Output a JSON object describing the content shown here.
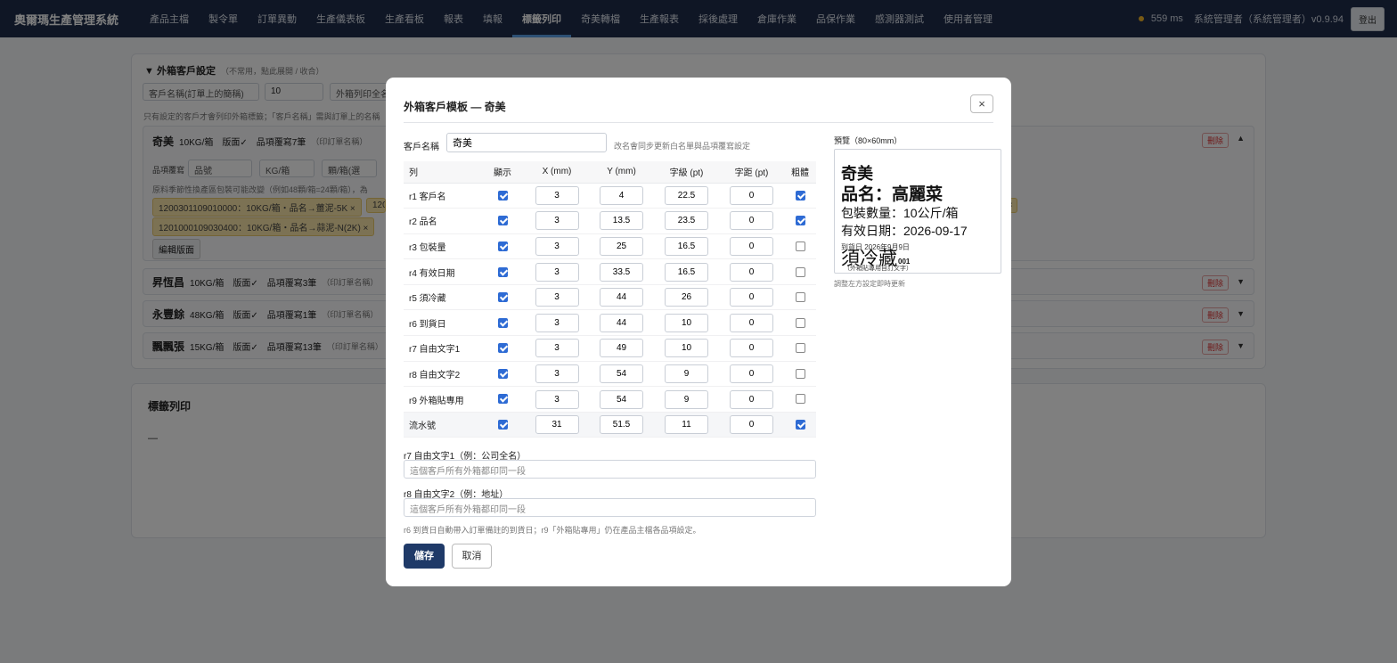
{
  "app": {
    "brand": "奧爾瑪生產管理系統"
  },
  "nav": {
    "items": [
      "產品主檔",
      "製令單",
      "訂單異動",
      "生產儀表板",
      "生產看板",
      "報表",
      "填報",
      "標籤列印",
      "奇美轉檔",
      "生產報表",
      "採後處理",
      "倉庫作業",
      "品保作業",
      "感測器測試",
      "使用者管理"
    ],
    "active": "標籤列印",
    "latency": "559 ms",
    "user": "系統管理者（系統管理者）v0.9.94",
    "logout": "登出"
  },
  "bg": {
    "section_title": "▼ 外箱客戶設定",
    "section_hint": "（不常用，點此展開 / 收合）",
    "field_customer_placeholder": "客戶名稱(訂單上的簡稱)",
    "field_qty": "10",
    "field_full_placeholder": "外箱列印全名",
    "note": "只有設定的客戶才會列印外箱標籤；「客戶名稱」需與訂單上的名稱",
    "customer_row": {
      "name": "奇美",
      "info": "10KG/箱　版面✓　品項覆寫7筆",
      "tag": "（印訂單名稱）"
    },
    "override_label": "品項覆寫",
    "override_fields": [
      "品號",
      "KG/箱",
      "顆/箱(選"
    ],
    "override_note": "原料季節性換產區包裝可能改變（例如48顆/箱=24顆/箱），為",
    "chips": [
      "1200301109010000：10KG/箱・品名→薑泥-5K ×",
      "1201000109030400：10KG/箱・品名→蒜泥-N(2K) ×"
    ],
    "chip_x": "×",
    "chip_trunc": "120",
    "edit_layout": "編輯版面",
    "rows": [
      {
        "name": "昇恆昌",
        "info": "10KG/箱　版面✓　品項覆寫3筆",
        "tag": "（印訂單名稱）"
      },
      {
        "name": "永豐餘",
        "info": "48KG/箱　版面✓　品項覆寫1筆",
        "tag": "（印訂單名稱）"
      },
      {
        "name": "飄飄張",
        "info": "15KG/箱　版面✓　品項覆寫13筆",
        "tag": "（印訂單名稱）"
      }
    ],
    "delete_label": "刪除",
    "label_print_title": "標籤列印",
    "label_print_dash": "—"
  },
  "modal": {
    "title": "外箱客戶模板 — 奇美",
    "close": "×",
    "customer_label": "客戶名稱",
    "customer_value": "奇美",
    "customer_hint": "改名會同步更新白名單與品項覆寫設定",
    "columns": [
      "列",
      "顯示",
      "X (mm)",
      "Y (mm)",
      "字級 (pt)",
      "字距 (pt)",
      "粗體"
    ],
    "rows": [
      {
        "label": "r1 客戶名",
        "show": true,
        "x": "3",
        "y": "4",
        "size": "22.5",
        "spacing": "0",
        "bold": true
      },
      {
        "label": "r2 品名",
        "show": true,
        "x": "3",
        "y": "13.5",
        "size": "23.5",
        "spacing": "0",
        "bold": true
      },
      {
        "label": "r3 包裝量",
        "show": true,
        "x": "3",
        "y": "25",
        "size": "16.5",
        "spacing": "0",
        "bold": false
      },
      {
        "label": "r4 有效日期",
        "show": true,
        "x": "3",
        "y": "33.5",
        "size": "16.5",
        "spacing": "0",
        "bold": false
      },
      {
        "label": "r5 須冷藏",
        "show": true,
        "x": "3",
        "y": "44",
        "size": "26",
        "spacing": "0",
        "bold": false
      },
      {
        "label": "r6 到貨日",
        "show": true,
        "x": "3",
        "y": "44",
        "size": "10",
        "spacing": "0",
        "bold": false
      },
      {
        "label": "r7 自由文字1",
        "show": true,
        "x": "3",
        "y": "49",
        "size": "10",
        "spacing": "0",
        "bold": false
      },
      {
        "label": "r8 自由文字2",
        "show": true,
        "x": "3",
        "y": "54",
        "size": "9",
        "spacing": "0",
        "bold": false
      },
      {
        "label": "r9 外箱貼專用",
        "show": true,
        "x": "3",
        "y": "54",
        "size": "9",
        "spacing": "0",
        "bold": false
      },
      {
        "label": "流水號",
        "show": true,
        "x": "31",
        "y": "51.5",
        "size": "11",
        "spacing": "0",
        "bold": true
      }
    ],
    "free1_label": "r7 自由文字1（例：公司全名）",
    "free1_placeholder": "這個客戶所有外箱都印同一段",
    "free2_label": "r8 自由文字2（例：地址）",
    "free2_placeholder": "這個客戶所有外箱都印同一段",
    "footnote": "r6 到貨日自動帶入訂單備註的到貨日；r9「外箱貼專用」仍在產品主檔各品項設定。",
    "save": "儲存",
    "cancel": "取消",
    "preview_title": "預覽（80×60mm）",
    "preview_hint": "調整左方設定即時更新",
    "preview": {
      "customer": "奇美",
      "product": "品名：高麗菜",
      "pack": "包裝數量：10公斤/箱",
      "expiry": "有效日期：2026-09-17",
      "arrival": "到貨日 2026年9月9日",
      "refrigerate": "須冷藏",
      "serial": "001",
      "box_note": "（外箱貼專用自訂文字）"
    }
  }
}
